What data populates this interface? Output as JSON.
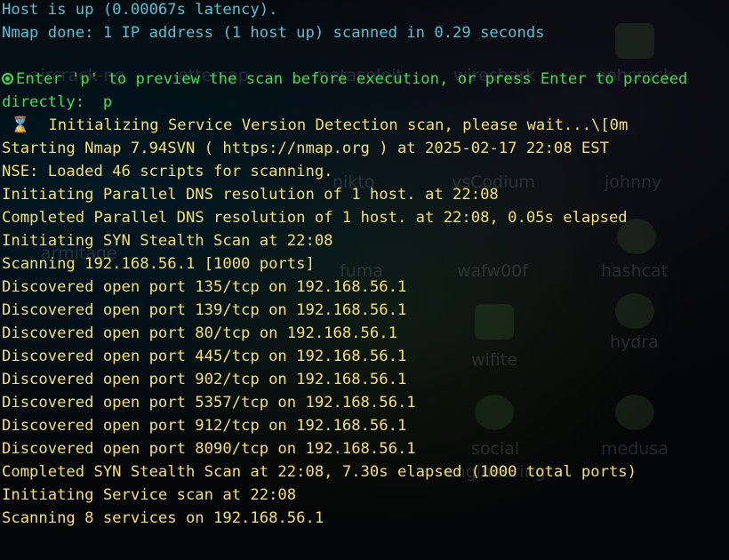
{
  "desktop": {
    "icons": [
      "aircrack-ng",
      "ettercap-",
      "metasploit",
      "wireshark",
      "ophcrack",
      "nikto",
      "vsCodium",
      "johnny",
      "armitage",
      "fuma",
      "wafw00f",
      "hashcat",
      "hydra",
      "wifite",
      "social",
      "medusa",
      "engineering"
    ]
  },
  "terminal": {
    "lines": [
      {
        "text": "Host is up (0.00067s latency).",
        "color": "cyan"
      },
      {
        "text": "Nmap done: 1 IP address (1 host up) scanned in 0.29 seconds",
        "color": "cyan"
      },
      {
        "text": "",
        "color": "cyan"
      },
      {
        "text": "Enter 'p' to preview the scan before execution, or press Enter to proceed",
        "color": "green",
        "icon": "radio-prompt-icon"
      },
      {
        "text": "directly:  ",
        "color": "green",
        "input": "p"
      },
      {
        "text": " ⌛  Initializing Service Version Detection scan, please wait...\\[0m",
        "color": "yellow"
      },
      {
        "text": "Starting Nmap 7.94SVN ( https://nmap.org ) at 2025-02-17 22:08 EST",
        "color": "yellow"
      },
      {
        "text": "NSE: Loaded 46 scripts for scanning.",
        "color": "yellow"
      },
      {
        "text": "Initiating Parallel DNS resolution of 1 host. at 22:08",
        "color": "yellow"
      },
      {
        "text": "Completed Parallel DNS resolution of 1 host. at 22:08, 0.05s elapsed",
        "color": "yellow"
      },
      {
        "text": "Initiating SYN Stealth Scan at 22:08",
        "color": "yellow"
      },
      {
        "text": "Scanning 192.168.56.1 [1000 ports]",
        "color": "yellow"
      },
      {
        "text": "Discovered open port 135/tcp on 192.168.56.1",
        "color": "yellow"
      },
      {
        "text": "Discovered open port 139/tcp on 192.168.56.1",
        "color": "yellow"
      },
      {
        "text": "Discovered open port 80/tcp on 192.168.56.1",
        "color": "yellow"
      },
      {
        "text": "Discovered open port 445/tcp on 192.168.56.1",
        "color": "yellow"
      },
      {
        "text": "Discovered open port 902/tcp on 192.168.56.1",
        "color": "yellow"
      },
      {
        "text": "Discovered open port 5357/tcp on 192.168.56.1",
        "color": "yellow"
      },
      {
        "text": "Discovered open port 912/tcp on 192.168.56.1",
        "color": "yellow"
      },
      {
        "text": "Discovered open port 8090/tcp on 192.168.56.1",
        "color": "yellow"
      },
      {
        "text": "Completed SYN Stealth Scan at 22:08, 7.30s elapsed (1000 total ports)",
        "color": "yellow"
      },
      {
        "text": "Initiating Service scan at 22:08",
        "color": "yellow"
      },
      {
        "text": "Scanning 8 services on 192.168.56.1",
        "color": "yellow"
      }
    ]
  }
}
